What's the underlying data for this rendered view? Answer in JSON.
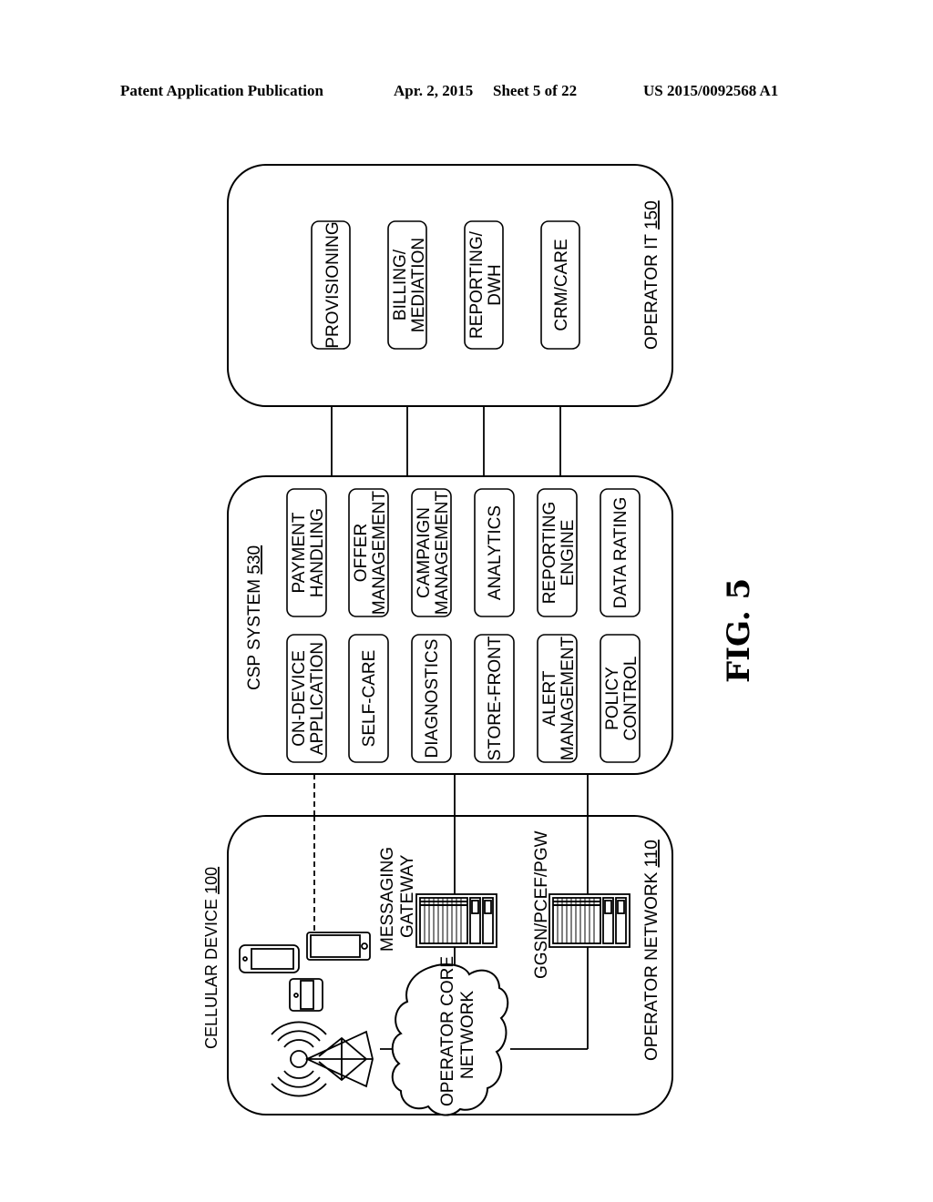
{
  "header": {
    "publication": "Patent Application Publication",
    "date": "Apr. 2, 2015",
    "sheet": "Sheet 5 of 22",
    "number": "US 2015/0092568 A1"
  },
  "figure_label": "FIG. 5",
  "operator_it": {
    "title": "OPERATOR IT",
    "ref": "150",
    "modules": [
      {
        "line1": "PROVISIONING",
        "line2": ""
      },
      {
        "line1": "BILLING/",
        "line2": "MEDIATION"
      },
      {
        "line1": "REPORTING/",
        "line2": "DWH"
      },
      {
        "line1": "CRM/CARE",
        "line2": ""
      }
    ]
  },
  "csp_system": {
    "title": "CSP SYSTEM",
    "ref": "530",
    "modules_left": [
      {
        "line1": "ON-DEVICE",
        "line2": "APPLICATION"
      },
      {
        "line1": "SELF-CARE",
        "line2": ""
      },
      {
        "line1": "DIAGNOSTICS",
        "line2": ""
      },
      {
        "line1": "STORE-FRONT",
        "line2": ""
      },
      {
        "line1": "ALERT",
        "line2": "MANAGEMENT"
      },
      {
        "line1": "POLICY",
        "line2": "CONTROL"
      }
    ],
    "modules_right": [
      {
        "line1": "PAYMENT",
        "line2": "HANDLING"
      },
      {
        "line1": "OFFER",
        "line2": "MANAGEMENT"
      },
      {
        "line1": "CAMPAIGN",
        "line2": "MANAGEMENT"
      },
      {
        "line1": "ANALYTICS",
        "line2": ""
      },
      {
        "line1": "REPORTING",
        "line2": "ENGINE"
      },
      {
        "line1": "DATA RATING",
        "line2": ""
      }
    ]
  },
  "operator_network": {
    "title": "OPERATOR NETWORK",
    "ref": "110",
    "cellular_device_title": "CELLULAR DEVICE",
    "cellular_device_ref": "100",
    "core_network_line1": "OPERATOR CORE",
    "core_network_line2": "NETWORK",
    "messaging_gateway_line1": "MESSAGING",
    "messaging_gateway_line2": "GATEWAY",
    "ggsn_label": "GGSN/PCEF/PGW"
  }
}
